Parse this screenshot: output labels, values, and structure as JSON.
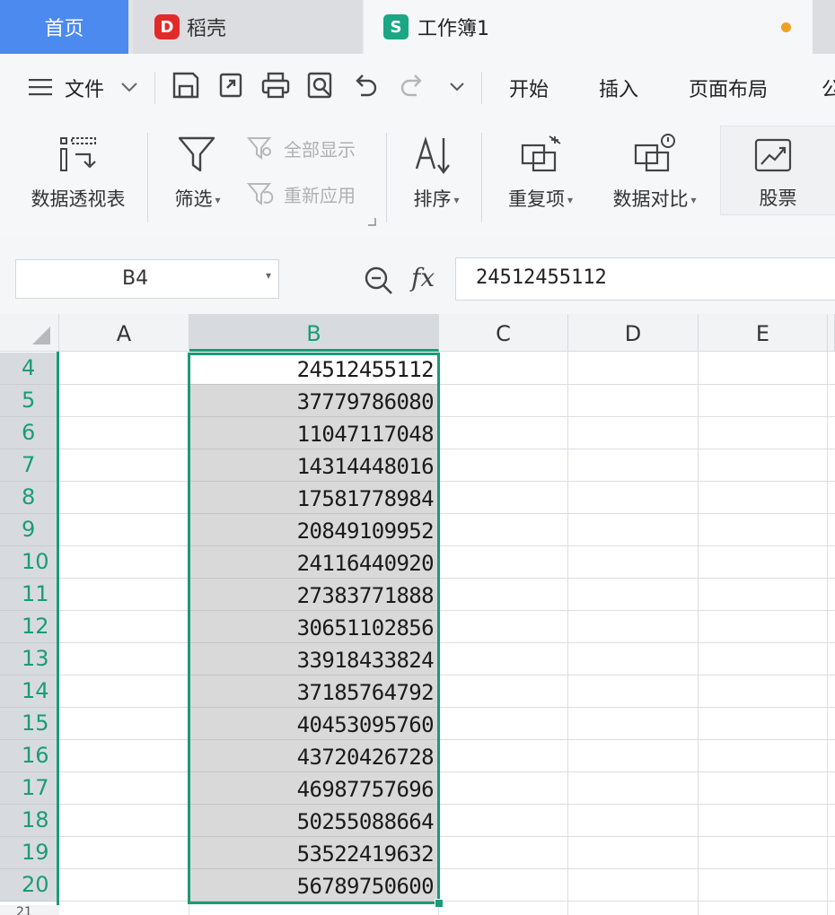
{
  "tabs": {
    "home": "首页",
    "daoke": "稻壳",
    "workbook": "工作簿1",
    "daoke_logo": "D",
    "workbook_logo": "S"
  },
  "menu": {
    "file": "文件",
    "start": "开始",
    "insert": "插入",
    "page_layout": "页面布局",
    "partial": "公"
  },
  "ribbon": {
    "pivot": "数据透视表",
    "filter": "筛选",
    "show_all": "全部显示",
    "reapply": "重新应用",
    "sort": "排序",
    "duplicates": "重复项",
    "compare": "数据对比",
    "stock": "股票"
  },
  "formula_bar": {
    "cell_ref": "B4",
    "fx": "fx",
    "value": "24512455112"
  },
  "columns": [
    "A",
    "B",
    "C",
    "D",
    "E"
  ],
  "rows": [
    {
      "num": "4",
      "b": "24512455112"
    },
    {
      "num": "5",
      "b": "37779786080"
    },
    {
      "num": "6",
      "b": "11047117048"
    },
    {
      "num": "7",
      "b": "14314448016"
    },
    {
      "num": "8",
      "b": "17581778984"
    },
    {
      "num": "9",
      "b": "20849109952"
    },
    {
      "num": "10",
      "b": "24116440920"
    },
    {
      "num": "11",
      "b": "27383771888"
    },
    {
      "num": "12",
      "b": "30651102856"
    },
    {
      "num": "13",
      "b": "33918433824"
    },
    {
      "num": "14",
      "b": "37185764792"
    },
    {
      "num": "15",
      "b": "40453095760"
    },
    {
      "num": "16",
      "b": "43720426728"
    },
    {
      "num": "17",
      "b": "46987757696"
    },
    {
      "num": "18",
      "b": "50255088664"
    },
    {
      "num": "19",
      "b": "53522419632"
    },
    {
      "num": "20",
      "b": "56789750600"
    }
  ],
  "colors": {
    "accent": "#1a9b77",
    "home_tab": "#4d8af0",
    "unsaved_dot": "#f0a020"
  }
}
